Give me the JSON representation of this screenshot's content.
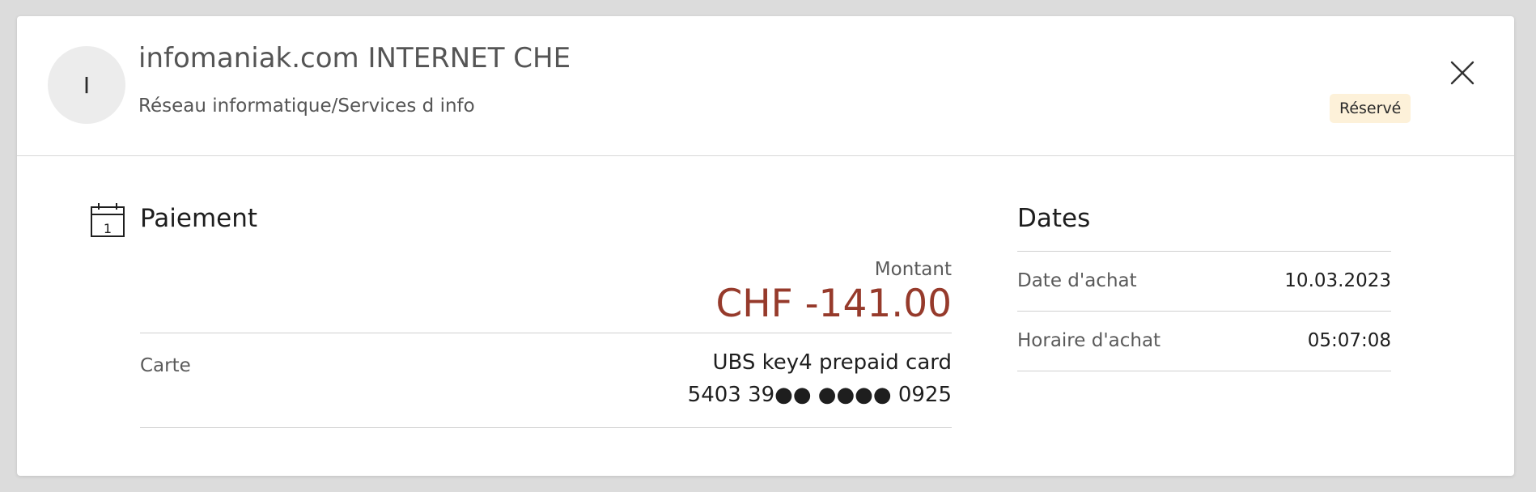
{
  "header": {
    "avatar_initial": "I",
    "merchant_name": "infomaniak.com INTERNET CHE",
    "category": "Réseau informatique/Services d info",
    "status": "Réservé",
    "status_color": "#fdf1d9"
  },
  "payment": {
    "title": "Paiement",
    "icon": "calendar-icon",
    "icon_day": "1",
    "amount_label": "Montant",
    "amount": "CHF -141.00",
    "amount_color": "#963a2b",
    "card_label": "Carte",
    "card_name": "UBS key4 prepaid card",
    "card_number": "5403 39●● ●●●● 0925"
  },
  "dates": {
    "title": "Dates",
    "rows": [
      {
        "label": "Date d'achat",
        "value": "10.03.2023"
      },
      {
        "label": "Horaire d'achat",
        "value": "05:07:08"
      }
    ]
  },
  "icons": {
    "close": "close-icon",
    "calendar": "calendar-icon"
  }
}
